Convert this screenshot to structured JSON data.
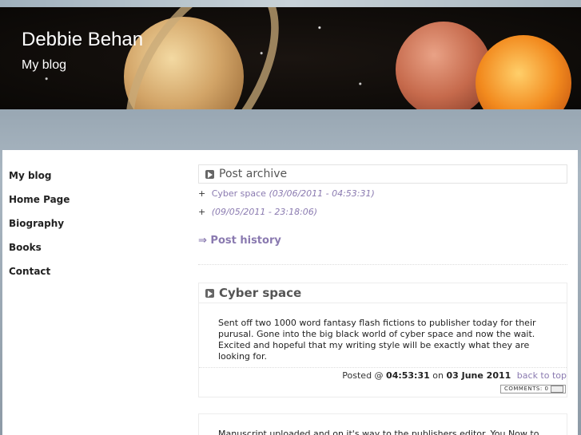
{
  "site": {
    "title": "Debbie Behan",
    "subtitle": "My blog"
  },
  "nav": [
    "My blog",
    "Home Page",
    "Biography",
    "Books",
    "Contact"
  ],
  "archive": {
    "heading": "Post archive",
    "items": [
      {
        "title": "Cyber space",
        "date": "(03/06/2011 - 04:53:31)"
      },
      {
        "title": "",
        "date": "(09/05/2011 - 23:18:06)"
      }
    ],
    "history_label": "⇒ Post history"
  },
  "post": {
    "title": "Cyber space",
    "body": "Sent off two 1000 word fantasy flash fictions to publisher today for their purusal. Gone into the big black world of cyber space and now the wait. Excited and hopeful that my writing style will be exactly what they are looking for.",
    "posted_prefix": "Posted @",
    "time": "04:53:31",
    "on": "on",
    "date": "03 June 2011",
    "back_to_top": "back to top",
    "comments": "COMMENTS: 0"
  },
  "post2": {
    "body": "Manuscript uploaded and on it's way to the publishers editor. You Now to"
  }
}
